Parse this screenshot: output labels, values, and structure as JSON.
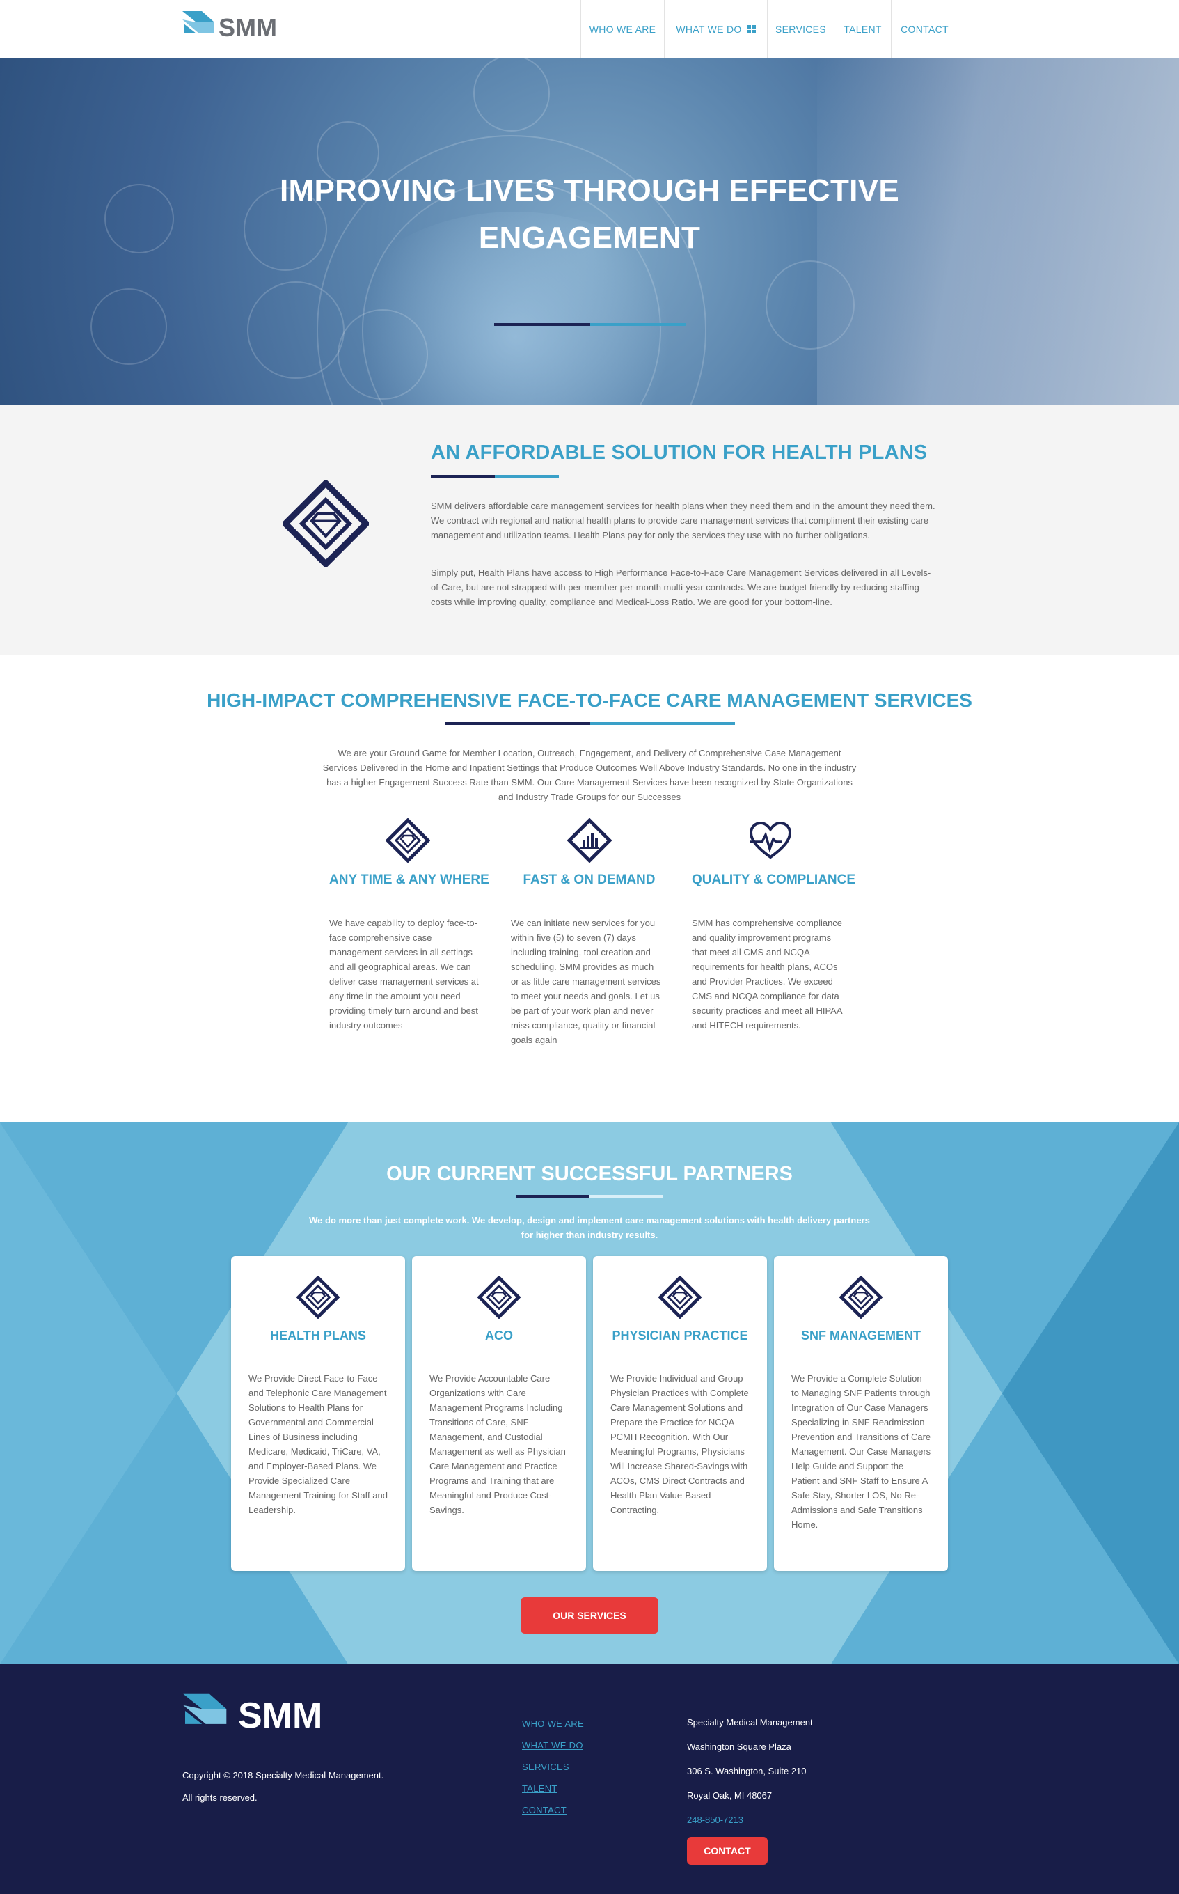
{
  "header": {
    "logo_text": "SMM",
    "nav": [
      "WHO WE ARE",
      "WHAT WE DO",
      "SERVICES",
      "TALENT",
      "CONTACT"
    ]
  },
  "hero": {
    "title_line1": "IMPROVING LIVES THROUGH EFFECTIVE",
    "title_line2": "ENGAGEMENT"
  },
  "affordable": {
    "title": "AN AFFORDABLE SOLUTION FOR HEALTH PLANS",
    "p1": "SMM delivers affordable care management services for health plans when they need them and in the amount they need them. We contract with regional and national health plans to provide care management services that compliment their existing care management and utilization teams. Health Plans pay for only the services they use with no further obligations.",
    "p2": "Simply put, Health Plans have access to High Performance Face-to-Face Care Management Services delivered in all Levels-of-Care, but are not strapped with per-member per-month multi-year contracts. We are budget friendly by reducing staffing costs while improving quality, compliance and Medical-Loss Ratio. We are good for your bottom-line."
  },
  "impact": {
    "title": "HIGH-IMPACT COMPREHENSIVE FACE-TO-FACE CARE MANAGEMENT SERVICES",
    "intro": "We are your Ground Game for Member Location, Outreach, Engagement, and Delivery of Comprehensive Case Management Services Delivered in the Home and Inpatient Settings that Produce Outcomes Well Above Industry Standards. No one in the industry has a higher Engagement Success Rate than SMM. Our Care Management Services have been recognized by State Organizations and Industry Trade Groups for our Successes",
    "features": [
      {
        "title": "ANY TIME & ANY WHERE",
        "icon": "diamond-gem-icon",
        "text": "We have capability to deploy face-to-face comprehensive case management services in all settings and all geographical areas. We can deliver case management services at any time in the amount you need providing timely turn around and best industry outcomes"
      },
      {
        "title": "FAST & ON DEMAND",
        "icon": "diamond-chart-icon",
        "text": "We can initiate new services for you within five (5) to seven (7) days including training, tool creation and scheduling. SMM provides as much or as little care management services to meet your needs and goals. Let us be part of your work plan and never miss compliance, quality or financial goals again"
      },
      {
        "title": "QUALITY & COMPLIANCE",
        "icon": "heartbeat-icon",
        "text": "SMM has comprehensive compliance and quality improvement programs that meet all CMS and NCQA requirements for health plans, ACOs and Provider Practices. We exceed CMS and NCQA compliance for data security practices and meet all HIPAA and HITECH requirements."
      }
    ]
  },
  "partners": {
    "title": "OUR CURRENT SUCCESSFUL PARTNERS",
    "subtitle": "We do more than just complete work. We develop, design and implement care management solutions with health delivery partners for higher than industry results.",
    "cards": [
      {
        "title": "HEALTH PLANS",
        "text": "We Provide Direct Face-to-Face and Telephonic Care Management Solutions to Health Plans for Governmental and Commercial Lines of Business including Medicare, Medicaid, TriCare, VA, and Employer-Based Plans. We Provide Specialized Care Management Training for Staff and Leadership."
      },
      {
        "title": "ACO",
        "text": "We Provide Accountable Care Organizations with Care Management Programs Including Transitions of Care, SNF Management, and Custodial Management as well as Physician Care Management and Practice Programs and Training that are Meaningful and Produce Cost-Savings."
      },
      {
        "title": "PHYSICIAN PRACTICE",
        "text": "We Provide Individual and Group Physician Practices with Complete Care Management Solutions and Prepare the Practice for NCQA PCMH Recognition. With Our Meaningful Programs, Physicians Will Increase Shared-Savings with ACOs, CMS Direct Contracts and Health Plan Value-Based Contracting."
      },
      {
        "title": "SNF MANAGEMENT",
        "text": "We Provide a Complete Solution to Managing SNF Patients through Integration of Our Case Managers Specializing in SNF Readmission Prevention and Transitions of Care Management. Our Case Managers Help Guide and Support the Patient and SNF Staff to Ensure A Safe Stay, Shorter LOS, No Re-Admissions and Safe Transitions Home."
      }
    ],
    "button": "OUR SERVICES"
  },
  "footer": {
    "logo_text": "SMM",
    "copyright": "Copyright © 2018 Specialty Medical Management.",
    "rights": "All rights reserved.",
    "links": [
      "WHO WE ARE",
      "WHAT WE DO",
      "SERVICES",
      "TALENT",
      "CONTACT"
    ],
    "address": {
      "company": "Specialty Medical Management",
      "building": "Washington Square Plaza",
      "street": "306 S. Washington, Suite 210",
      "city": "Royal Oak, MI 48067",
      "phone": "248-850-7213"
    },
    "button": "CONTACT"
  },
  "colors": {
    "accent": "#3aa0c8",
    "navy": "#1c2354",
    "footer_bg": "#181d48",
    "button_red": "#e83a3a",
    "partners_bg": "#56a9cf"
  }
}
